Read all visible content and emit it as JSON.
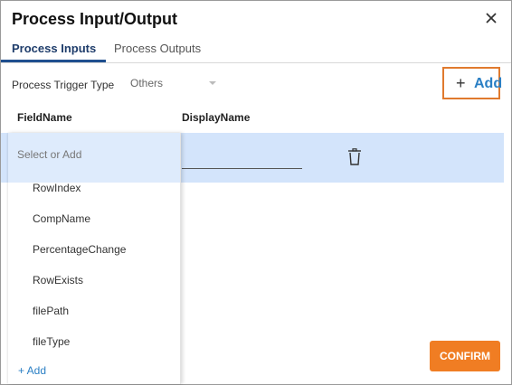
{
  "dialog": {
    "title": "Process Input/Output",
    "close_icon": "close-icon"
  },
  "tabs": [
    {
      "label": "Process Inputs",
      "active": true
    },
    {
      "label": "Process Outputs",
      "active": false
    }
  ],
  "trigger": {
    "label": "Process Trigger Type",
    "value": "Others"
  },
  "add_button": {
    "plus": "+",
    "label": "Add"
  },
  "columns": {
    "field_name": "FieldName",
    "display_name": "DisplayName"
  },
  "dropdown": {
    "placeholder": "Select or Add",
    "options": [
      "RowIndex",
      "CompName",
      "PercentageChange",
      "RowExists",
      "filePath",
      "fileType"
    ],
    "add_label": "+ Add"
  },
  "confirm_label": "CONFIRM",
  "colors": {
    "accent_orange": "#f07d23",
    "link_blue": "#2a7fc4",
    "row_highlight": "#d3e4fb",
    "tab_active": "#1f3d6b"
  },
  "icons": {
    "trash": "trash-icon",
    "caret": "chevron-down-icon"
  }
}
